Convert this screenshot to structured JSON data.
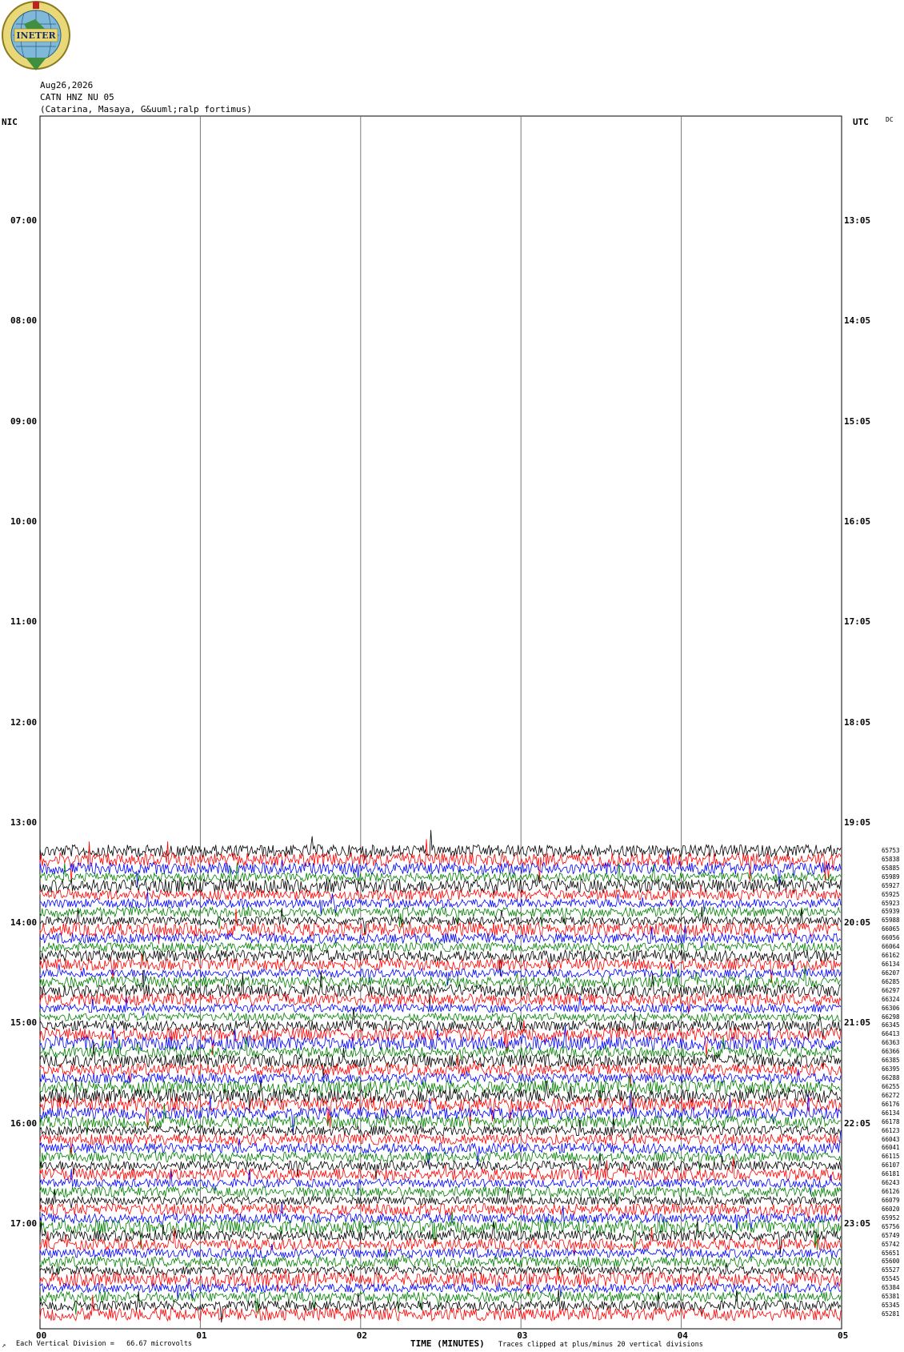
{
  "logo": {
    "text": "INETER",
    "icon": "ineter-logo-globe-icon"
  },
  "header": {
    "date": "Aug26,2026",
    "station": "CATN HNZ NU 05",
    "location": "(Catarina, Masaya, G&uuml;ralp fortimus)"
  },
  "tz_left": "NIC",
  "tz_right": "UTC",
  "dc_label": "DC",
  "chart_data": {
    "type": "line",
    "title": "",
    "xlabel": "TIME (MINUTES)",
    "ylabel": "",
    "xlim": [
      0,
      5
    ],
    "x_ticks": [
      "00",
      "01",
      "02",
      "03",
      "04",
      "05"
    ],
    "left_time_labels": [
      "07:00",
      "08:00",
      "09:00",
      "10:00",
      "11:00",
      "12:00",
      "13:00",
      "14:00",
      "15:00",
      "16:00",
      "17:00"
    ],
    "right_time_labels": [
      "13:05",
      "14:05",
      "15:05",
      "16:05",
      "17:05",
      "18:05",
      "19:05",
      "20:05",
      "21:05",
      "22:05",
      "23:05"
    ],
    "trace_start_time": "13:05",
    "trace_interval_minutes": 5,
    "trace_colors": [
      "#000000",
      "#ff0000",
      "#0000ff",
      "#008000"
    ],
    "grid": true,
    "trace_counts": [
      "65753",
      "65838",
      "65885",
      "65989",
      "65927",
      "65925",
      "65923",
      "65939",
      "65988",
      "66065",
      "66056",
      "66064",
      "66162",
      "66134",
      "66207",
      "66285",
      "66297",
      "66324",
      "66306",
      "66298",
      "66345",
      "66413",
      "66363",
      "66366",
      "66385",
      "66395",
      "66288",
      "66255",
      "66272",
      "66176",
      "66134",
      "66178",
      "66123",
      "66043",
      "66041",
      "66115",
      "66107",
      "66181",
      "66243",
      "66126",
      "66079",
      "66020",
      "65952",
      "65756",
      "65749",
      "65742",
      "65651",
      "65600",
      "65527",
      "65545",
      "65384",
      "65381",
      "65345",
      "65281"
    ]
  },
  "footer": {
    "division": "Each Vertical Division =   66.67 microvolts",
    "clip_note": "Traces clipped at plus/minus 20 vertical divisions",
    "corner_mark": "↗"
  }
}
